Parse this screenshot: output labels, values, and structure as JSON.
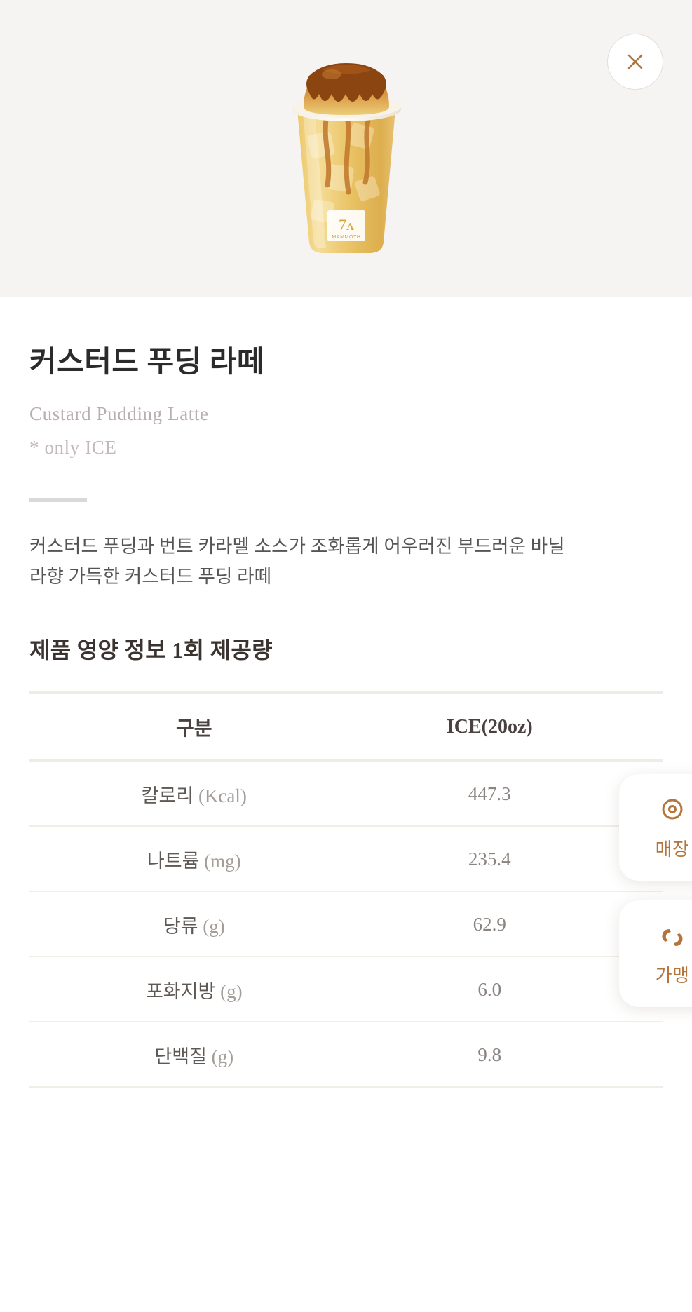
{
  "header": {
    "close_icon": "close-icon",
    "close_label": "닫기"
  },
  "product": {
    "image_alt": "커스터드 푸딩 라떼 아이스 컵 이미지",
    "title": "커스터드 푸딩 라떼",
    "subtitle_en": "Custard Pudding Latte",
    "note": "* only ICE",
    "description": "커스터드 푸딩과 번트 카라멜 소스가 조화롭게 어우러진 부드러운 바닐라향 가득한 커스터드 푸딩 라떼"
  },
  "nutrition": {
    "section_title": "제품 영양 정보 1회 제공량",
    "columns": [
      "구분",
      "ICE(20oz)"
    ],
    "rows": [
      {
        "label": "칼로리",
        "unit": "(Kcal)",
        "value": "447.3"
      },
      {
        "label": "나트륨",
        "unit": "(mg)",
        "value": "235.4"
      },
      {
        "label": "당류",
        "unit": "(g)",
        "value": "62.9"
      },
      {
        "label": "포화지방",
        "unit": "(g)",
        "value": "6.0"
      },
      {
        "label": "단백질",
        "unit": "(g)",
        "value": "9.8"
      }
    ]
  },
  "floating_buttons": [
    {
      "label": "매장",
      "icon": "location-pin-icon"
    },
    {
      "label": "가맹",
      "icon": "handshake-icon"
    }
  ],
  "colors": {
    "accent": "#b5743b",
    "hero_bg": "#f5f4f2",
    "title": "#2b2b2b",
    "muted": "#b9aeae",
    "table_border": "#efece6"
  }
}
